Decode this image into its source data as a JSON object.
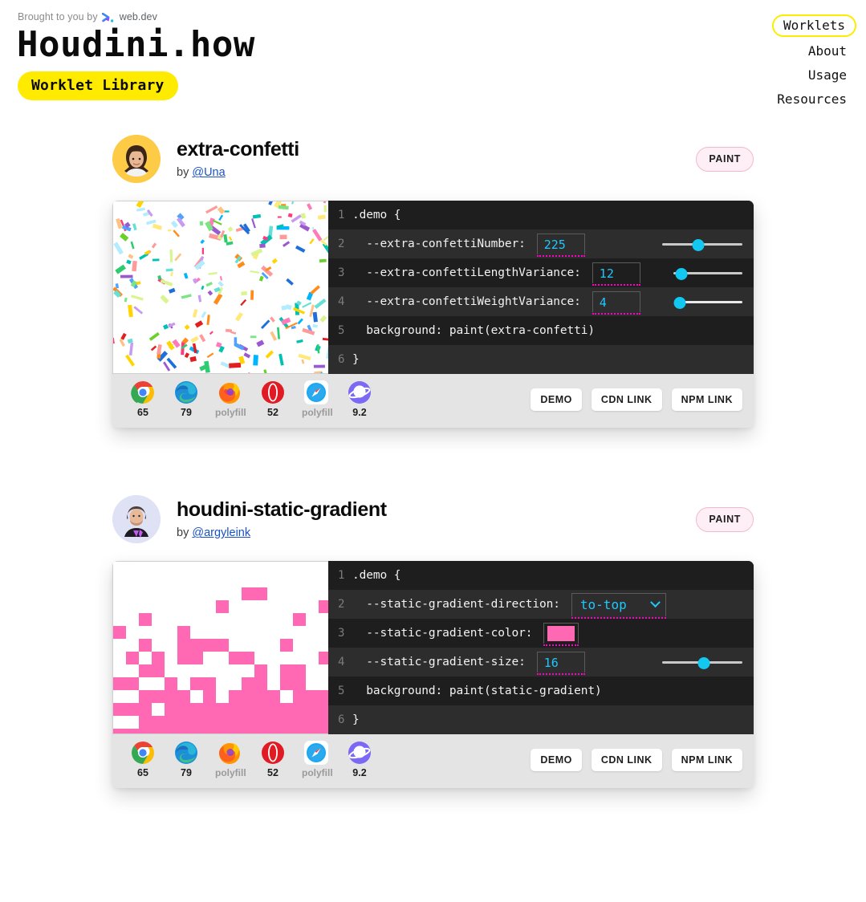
{
  "header": {
    "brought_prefix": "Brought to you by",
    "brought_brand": "web.dev",
    "title": "Houdini.how",
    "tagline": "Worklet Library",
    "nav": [
      {
        "label": "Worklets",
        "active": true
      },
      {
        "label": "About",
        "active": false
      },
      {
        "label": "Usage",
        "active": false
      },
      {
        "label": "Resources",
        "active": false
      }
    ]
  },
  "colors": {
    "accent_yellow": "#ffeb00",
    "badge_border": "#f3b8cf",
    "badge_bg": "#fdeff5",
    "slider_thumb": "#12c7f0",
    "code_value": "#1ec8ff",
    "dotted_underline": "#ff00c8",
    "swatch_pink": "#ff69b4",
    "card_bg": "#e4e4e4",
    "code_bg_odd": "#1e1e1e",
    "code_bg_even": "#2d2d2d",
    "link_blue": "#1a52c4"
  },
  "browsers": [
    {
      "name": "chrome-icon",
      "version": "65",
      "polyfill": false
    },
    {
      "name": "edge-icon",
      "version": "79",
      "polyfill": false
    },
    {
      "name": "firefox-icon",
      "version": "polyfill",
      "polyfill": true
    },
    {
      "name": "opera-icon",
      "version": "52",
      "polyfill": false
    },
    {
      "name": "safari-icon",
      "version": "polyfill",
      "polyfill": true
    },
    {
      "name": "samsung-internet-icon",
      "version": "9.2",
      "polyfill": false
    }
  ],
  "actions": {
    "demo": "DEMO",
    "cdn": "CDN LINK",
    "npm": "NPM LINK"
  },
  "worklets": [
    {
      "name": "extra-confetti",
      "by_prefix": "by",
      "author": "@Una",
      "badge": "PAINT",
      "avatar_bg": "#fecb46",
      "preview_type": "confetti",
      "code": [
        {
          "line": "1",
          "text": ".demo {",
          "control": "none"
        },
        {
          "line": "2",
          "text": "  --extra-confettiNumber:",
          "control": "slider",
          "value": "225",
          "slider_pct": 45
        },
        {
          "line": "3",
          "text": "  --extra-confettiLengthVariance:",
          "control": "slider",
          "value": "12",
          "slider_pct": 12
        },
        {
          "line": "4",
          "text": "  --extra-confettiWeightVariance:",
          "control": "slider",
          "value": "4",
          "slider_pct": 4
        },
        {
          "line": "5",
          "text": "  background: paint(extra-confetti)",
          "control": "none"
        },
        {
          "line": "6",
          "text": "}",
          "control": "none"
        }
      ]
    },
    {
      "name": "houdini-static-gradient",
      "by_prefix": "by",
      "author": "@argyleink",
      "badge": "PAINT",
      "avatar_bg": "#dfe1f4",
      "preview_type": "gradient",
      "code": [
        {
          "line": "1",
          "text": ".demo {",
          "control": "none"
        },
        {
          "line": "2",
          "text": "  --static-gradient-direction:",
          "control": "select",
          "value": "to-top"
        },
        {
          "line": "3",
          "text": "  --static-gradient-color:",
          "control": "color",
          "value": "#ff69b4"
        },
        {
          "line": "4",
          "text": "  --static-gradient-size:",
          "control": "slider",
          "value": "16",
          "slider_pct": 52
        },
        {
          "line": "5",
          "text": "  background: paint(static-gradient)",
          "control": "none"
        },
        {
          "line": "6",
          "text": "}",
          "control": "none"
        }
      ]
    }
  ]
}
